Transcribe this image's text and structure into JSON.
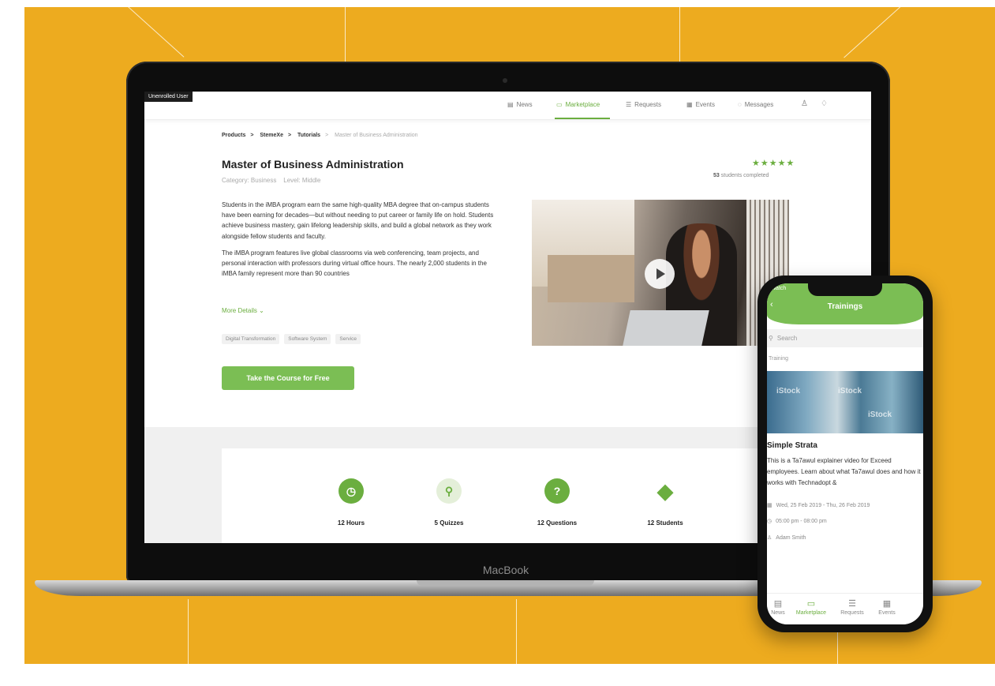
{
  "colors": {
    "background": "#EDAB1F",
    "accent": "#6BAE3F",
    "cta": "#7BBE54"
  },
  "laptop": {
    "brand": "MacBook",
    "user_badge": "Unenrolled User",
    "nav": {
      "news": "News",
      "marketplace": "Marketplace",
      "requests": "Requests",
      "events": "Events",
      "messages": "Messages",
      "active": "Marketplace"
    },
    "breadcrumb": [
      "Products",
      "StemeXe",
      "Tutorials",
      "Master of Business Administration"
    ],
    "course": {
      "title": "Master of Business Administration",
      "category": "Category: Business",
      "level": "Level: Middle",
      "rating_stars": "★★★★★",
      "rating": 5,
      "completed_count": "53",
      "completed_label": "students completed",
      "description_1": "Students in the iMBA program earn the same high-quality MBA degree that on-campus students have been earning for decades—but without needing to put career or family life on hold. Students achieve business mastery, gain lifelong leadership skills, and build a global network as they work alongside fellow students and faculty.",
      "description_2": "The iMBA program features live global classrooms via web conferencing, team projects, and personal interaction with professors during virtual office hours. The nearly 2,000 students in the iMBA family represent more than 90 countries",
      "more_details": "More Details",
      "tags": [
        "Digital Transformation",
        "Software System",
        "Service"
      ],
      "cta": "Take the Course for Free"
    },
    "stats": [
      {
        "label": "12 Hours",
        "icon": "clock-icon"
      },
      {
        "label": "5 Quizzes",
        "icon": "quiz-search-icon"
      },
      {
        "label": "12 Questions",
        "icon": "question-icon"
      },
      {
        "label": "12 Students",
        "icon": "graduation-cap-icon"
      }
    ]
  },
  "phone": {
    "status_left": "watch",
    "title": "Trainings",
    "search_placeholder": "Search",
    "section": "Training",
    "image_watermark": "iStock",
    "item_title": "Simple Strata",
    "item_description": "This is a Ta7awul explainer video for Exceed employees. Learn about what Ta7awul does and how it works with Technadopt &",
    "date_range": "Wed, 25 Feb 2019 - Thu, 26 Feb 2019",
    "time_range": "05:00 pm - 08:00 pm",
    "presenter": "Adam Smith",
    "tabs": [
      "News",
      "Marketplace",
      "Requests",
      "Events"
    ],
    "active_tab": "Marketplace"
  }
}
